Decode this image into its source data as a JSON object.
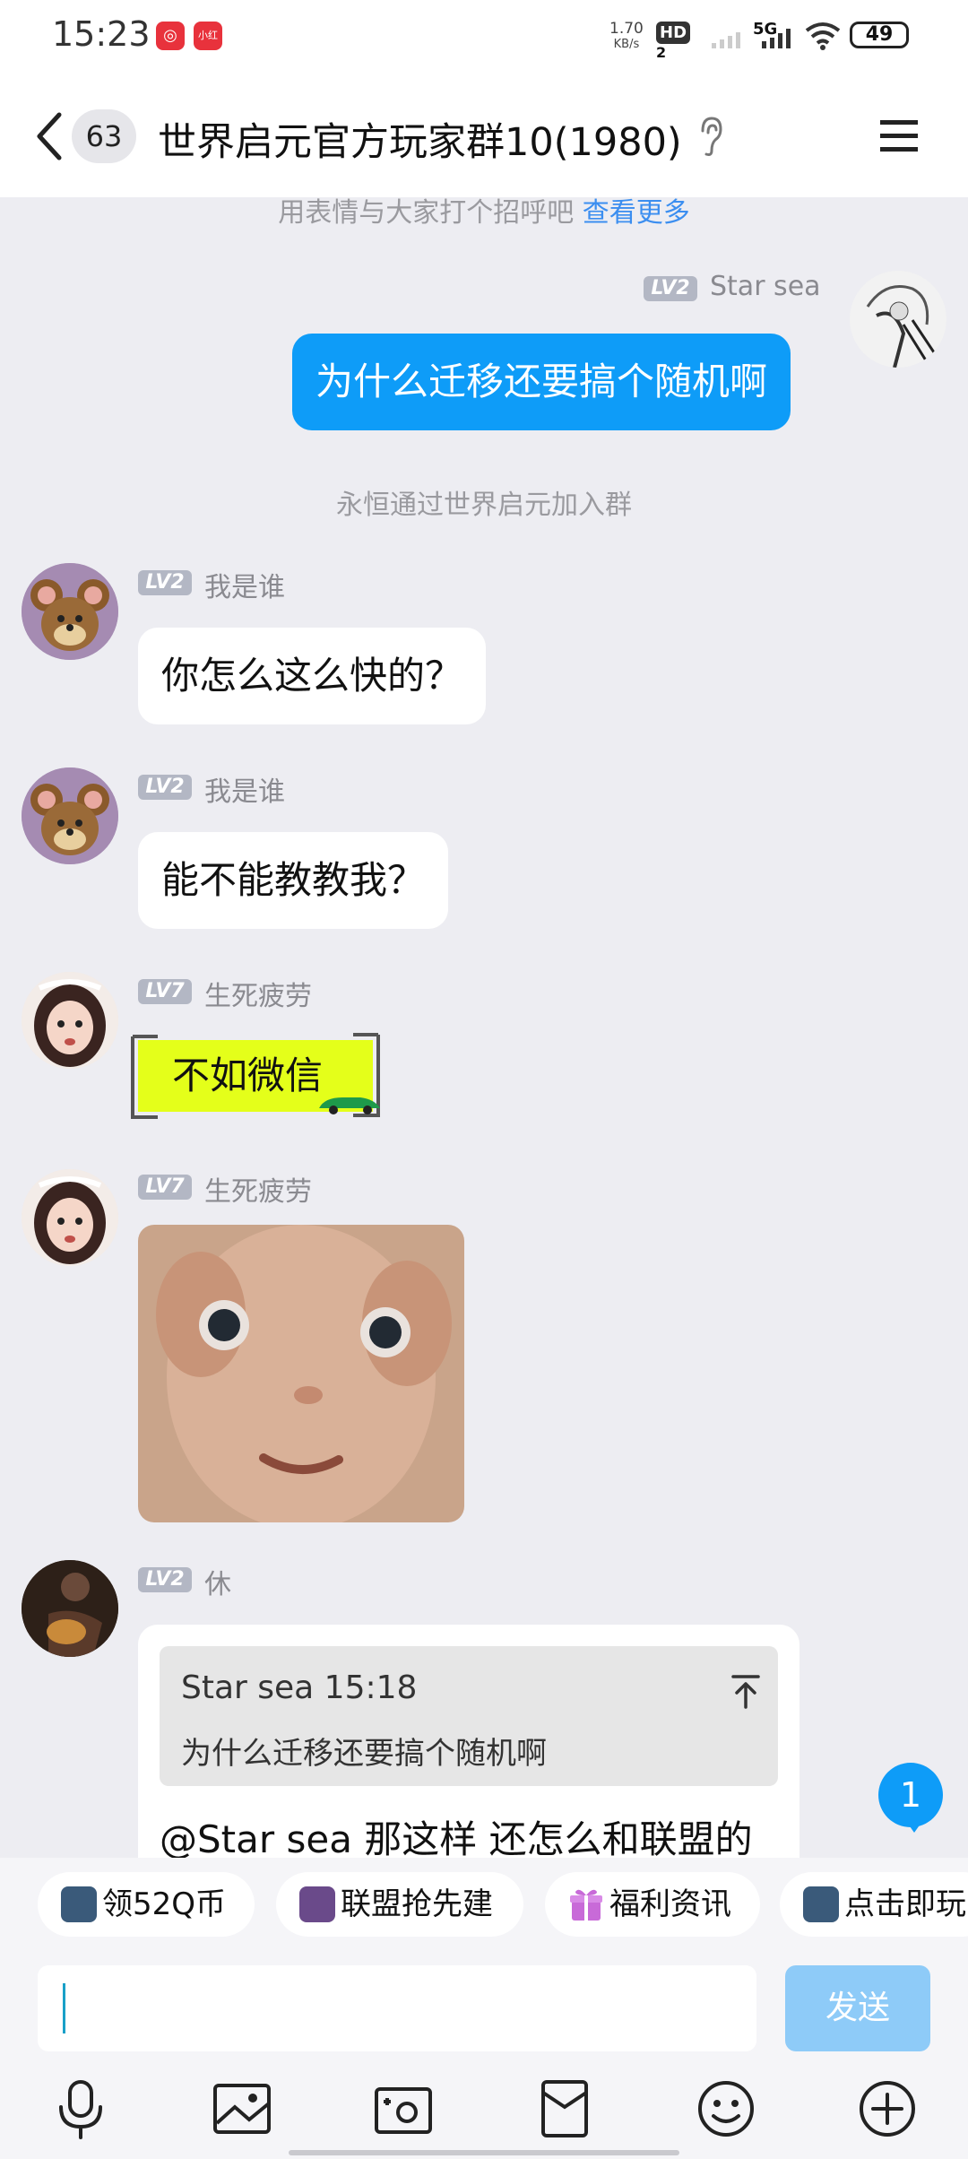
{
  "status_bar": {
    "time": "15:23",
    "app_icons": [
      "netease-music-icon",
      "xiaohongshu-icon"
    ],
    "app2_text": "小红书",
    "net_speed_value": "1.70",
    "net_speed_unit": "KB/s",
    "hd_badge": "HD",
    "hd_sub": "2",
    "network": "5G",
    "battery": "49"
  },
  "header": {
    "unread_count": "63",
    "title": "世界启元官方玩家群10(1980)"
  },
  "chat": {
    "system_hint": "用表情与大家打个招呼吧",
    "system_hint_link": "查看更多",
    "join_notice": "永恒通过世界启元加入群",
    "messages": [
      {
        "sender": "Star sea",
        "level": "LV2",
        "text": "为什么迁移还要搞个随机啊",
        "mine": true
      },
      {
        "sender": "我是谁",
        "level": "LV2",
        "text": "你怎么这么快的？"
      },
      {
        "sender": "我是谁",
        "level": "LV2",
        "text": "能不能教教我？"
      },
      {
        "sender": "生死疲劳",
        "level": "LV7",
        "text": "不如微信"
      },
      {
        "sender": "生死疲劳",
        "level": "LV7",
        "text": ""
      },
      {
        "sender": "休",
        "level": "LV2",
        "quote_header": "Star sea 15:18",
        "quote_text": "为什么迁移还要搞个随机啊",
        "text": "@Star sea 那这样 还怎么和联盟的"
      }
    ],
    "new_message_count": "1"
  },
  "quick_bar": {
    "chips": [
      "领52Q币",
      "联盟抢先建",
      "福利资讯",
      "点击即玩"
    ]
  },
  "input": {
    "placeholder": "",
    "send_label": "发送"
  },
  "toolbar": [
    "microphone-icon",
    "image-icon",
    "camera-icon",
    "red-packet-icon",
    "emoji-icon",
    "plus-icon"
  ],
  "colors": {
    "accent": "#0e9cf8",
    "chat_background": "#ededf2",
    "send_disabled": "#8ecbf8",
    "sticker_yellow": "#e4ff1a"
  }
}
